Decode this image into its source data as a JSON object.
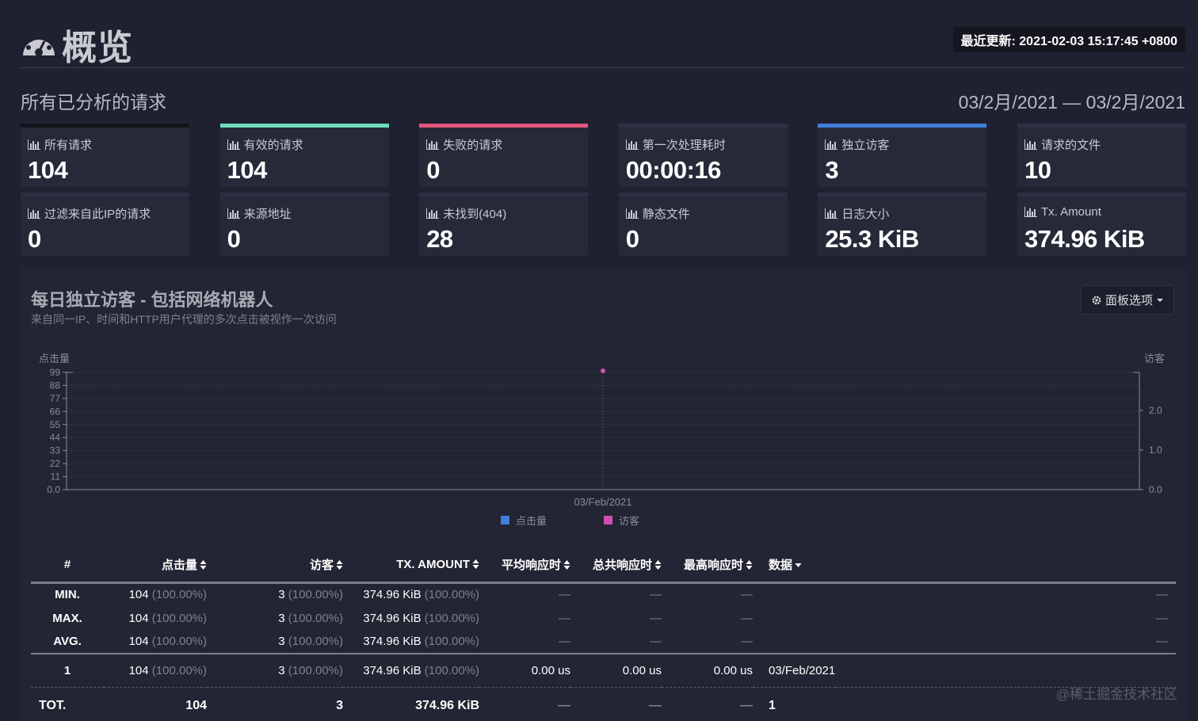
{
  "header": {
    "title": "概览",
    "last_updated": "最近更新: 2021-02-03 15:17:45 +0800"
  },
  "overview": {
    "section_title": "所有已分析的请求",
    "date_range": "03/2月/2021 — 03/2月/2021",
    "cards": [
      {
        "label": "所有请求",
        "value": "104",
        "accent": "#13141b"
      },
      {
        "label": "有效的请求",
        "value": "104",
        "accent": "#6fdcbb"
      },
      {
        "label": "失败的请求",
        "value": "0",
        "accent": "#e2567a"
      },
      {
        "label": "第一次处理耗时",
        "value": "00:00:16",
        "accent": "#2c3042"
      },
      {
        "label": "独立访客",
        "value": "3",
        "accent": "#3f7fd9"
      },
      {
        "label": "请求的文件",
        "value": "10",
        "accent": "#2c3042"
      },
      {
        "label": "过滤来自此IP的请求",
        "value": "0"
      },
      {
        "label": "来源地址",
        "value": "0"
      },
      {
        "label": "未找到(404)",
        "value": "28"
      },
      {
        "label": "静态文件",
        "value": "0"
      },
      {
        "label": "日志大小",
        "value": "25.3 KiB"
      },
      {
        "label": "Tx. Amount",
        "value": "374.96 KiB"
      }
    ]
  },
  "panel": {
    "title": "每日独立访客 - 包括网络机器人",
    "subtitle": "来自同一IP、时间和HTTP用户代理的多次点击被视作一次访问",
    "options_label": "面板选项"
  },
  "chart_data": {
    "type": "scatter",
    "x": [
      "03/Feb/2021"
    ],
    "series": [
      {
        "name": "点击量",
        "values": [
          104
        ],
        "color": "#3f7fd9",
        "axis": "left"
      },
      {
        "name": "访客",
        "values": [
          3
        ],
        "color": "#d14fb1",
        "axis": "right"
      }
    ],
    "ylabel": "点击量",
    "y2label": "访客",
    "ylim": [
      0,
      99
    ],
    "y_ticks": [
      "0.0",
      "11",
      "22",
      "33",
      "44",
      "55",
      "66",
      "77",
      "88",
      "99"
    ],
    "y2_ticks": [
      "0.0",
      "1.0",
      "2.0"
    ],
    "grid": true,
    "legend": "bottom-center"
  },
  "table": {
    "headers": [
      "#",
      "点击量",
      "访客",
      "TX. AMOUNT",
      "平均响应时",
      "总共响应时",
      "最高响应时",
      "数据"
    ],
    "summary_rows": [
      {
        "label": "MIN.",
        "hits": "104",
        "hits_pct": "(100.00%)",
        "visitors": "3",
        "visitors_pct": "(100.00%)",
        "tx": "374.96 KiB",
        "tx_pct": "(100.00%)",
        "avg": "—",
        "total": "—",
        "max": "—",
        "data": "",
        "end": "—"
      },
      {
        "label": "MAX.",
        "hits": "104",
        "hits_pct": "(100.00%)",
        "visitors": "3",
        "visitors_pct": "(100.00%)",
        "tx": "374.96 KiB",
        "tx_pct": "(100.00%)",
        "avg": "—",
        "total": "—",
        "max": "—",
        "data": "",
        "end": "—"
      },
      {
        "label": "AVG.",
        "hits": "104",
        "hits_pct": "(100.00%)",
        "visitors": "3",
        "visitors_pct": "(100.00%)",
        "tx": "374.96 KiB",
        "tx_pct": "(100.00%)",
        "avg": "—",
        "total": "—",
        "max": "—",
        "data": "",
        "end": "—"
      }
    ],
    "data_row": {
      "label": "1",
      "hits": "104",
      "hits_pct": "(100.00%)",
      "visitors": "3",
      "visitors_pct": "(100.00%)",
      "tx": "374.96 KiB",
      "tx_pct": "(100.00%)",
      "avg": "0.00 us",
      "total": "0.00 us",
      "max": "0.00 us",
      "data": "03/Feb/2021"
    },
    "total_row": {
      "label": "TOT.",
      "hits": "104",
      "visitors": "3",
      "tx": "374.96 KiB",
      "avg": "—",
      "total": "—",
      "max": "—",
      "data": "1"
    }
  },
  "watermark": "@稀土掘金技术社区"
}
